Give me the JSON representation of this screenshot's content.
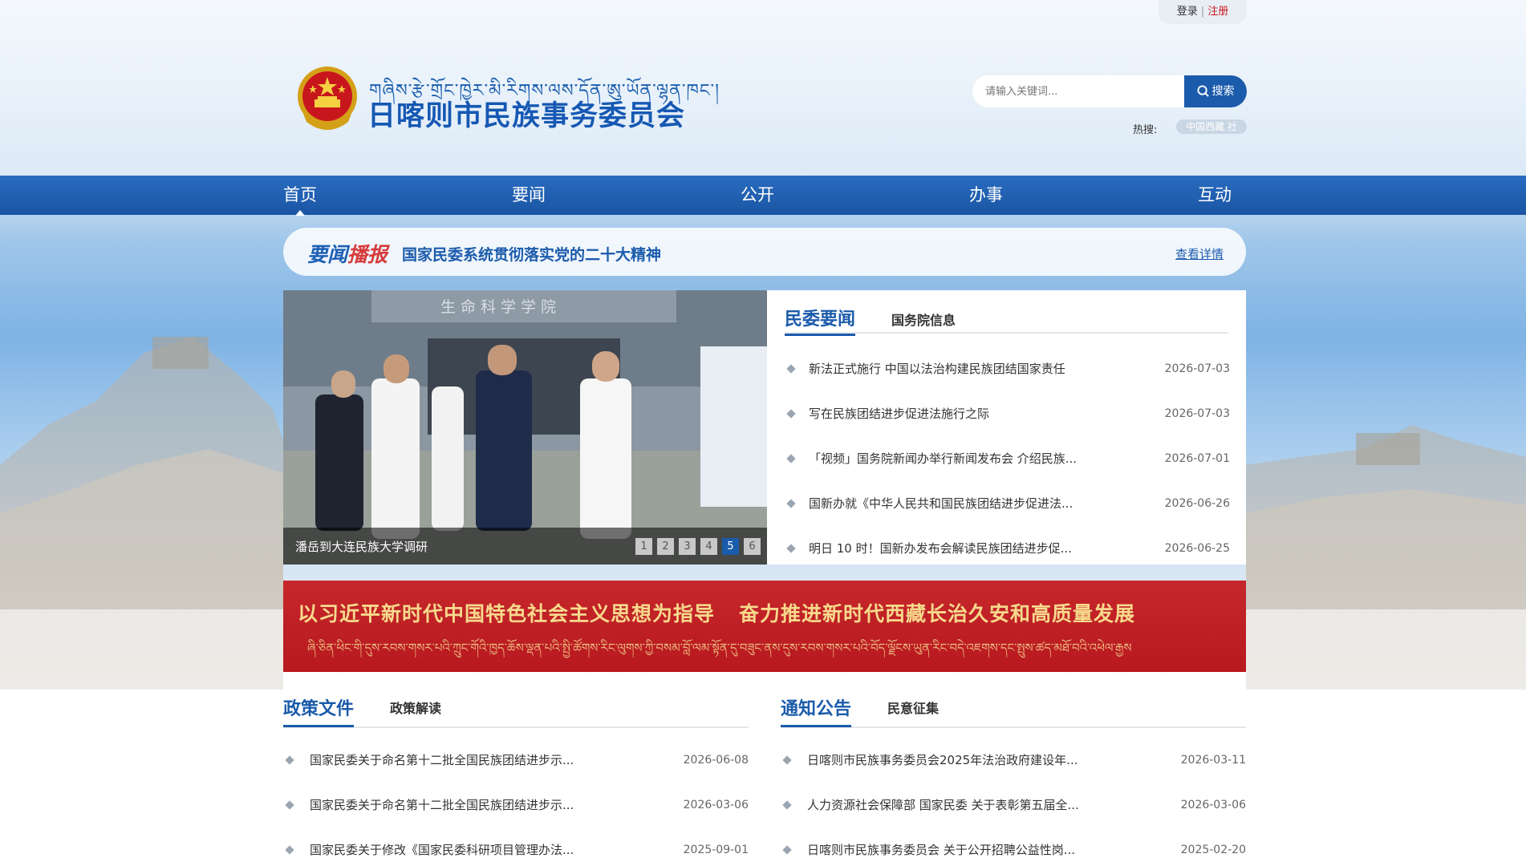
{
  "top_bar": {
    "login": "登录",
    "separator": "|",
    "register": "注册"
  },
  "header": {
    "tibetan_title": "གཞིས་རྩེ་གྲོང་ཁྱེར་མི་རིགས་ལས་དོན་ཨུ་ཡོན་ལྷན་ཁང་།",
    "cn_title": "日喀则市民族事务委员会"
  },
  "search": {
    "placeholder": "请输入关键词...",
    "button_label": "搜索",
    "hot_label": "热搜:",
    "hot_tag": "中国西藏 社"
  },
  "nav": {
    "items": [
      "首页",
      "要闻",
      "公开",
      "办事",
      "互动"
    ]
  },
  "ticker": {
    "logo_main": "要闻",
    "logo_accent": "播报",
    "headline": "国家民委系统贯彻落实党的二十大精神",
    "more": "查看详情"
  },
  "slider": {
    "caption": "潘岳到大连民族大学调研",
    "dots": [
      "1",
      "2",
      "3",
      "4",
      "5",
      "6"
    ],
    "active_dot": 5,
    "photo_sign": "生命科学学院"
  },
  "news_panel": {
    "tab_main": "民委要闻",
    "tab_sub": "国务院信息",
    "items": [
      {
        "title": "新法正式施行 中国以法治构建民族团结国家责任",
        "date": "2026-07-03"
      },
      {
        "title": "写在民族团结进步促进法施行之际",
        "date": "2026-07-03"
      },
      {
        "title": "「视频」国务院新闻办举行新闻发布会 介绍民族...",
        "date": "2026-07-01"
      },
      {
        "title": "国新办就《中华人民共和国民族团结进步促进法...",
        "date": "2026-06-26"
      },
      {
        "title": "明日 10 时！国新办发布会解读民族团结进步促...",
        "date": "2026-06-25"
      }
    ]
  },
  "banner": {
    "line1_a": "以习近平新时代中国特色社会主义思想为指导",
    "line1_b": "奋力推进新时代西藏长治久安和高质量发展",
    "line2": "ཞི་ཅིན་ཕིང་གི་དུས་རབས་གསར་པའི་ཀྲུང་གོའི་ཁྱད་ཆོས་ལྡན་པའི་སྤྱི་ཚོགས་རིང་ལུགས་ཀྱི་བསམ་བློ་ལམ་སྟོན་དུ་བཟུང་ནས་དུས་རབས་གསར་པའི་བོད་ལྗོངས་ཡུན་རིང་བདེ་འཇགས་དང་སྤུས་ཚད་མཐོ་བའི་འཕེལ་རྒྱས"
  },
  "policy": {
    "tab_main": "政策文件",
    "tab_sub": "政策解读",
    "items": [
      {
        "title": "国家民委关于命名第十二批全国民族团结进步示...",
        "date": "2026-06-08"
      },
      {
        "title": "国家民委关于命名第十二批全国民族团结进步示...",
        "date": "2026-03-06"
      },
      {
        "title": "国家民委关于修改《国家民委科研项目管理办法...",
        "date": "2025-09-01"
      }
    ]
  },
  "notice": {
    "tab_main": "通知公告",
    "tab_sub": "民意征集",
    "items": [
      {
        "title": "日喀则市民族事务委员会2025年法治政府建设年...",
        "date": "2026-03-11"
      },
      {
        "title": "人力资源社会保障部 国家民委 关于表彰第五届全...",
        "date": "2026-03-06"
      },
      {
        "title": "日喀则市民族事务委员会 关于公开招聘公益性岗...",
        "date": "2025-02-20"
      }
    ]
  },
  "colors": {
    "primary": "#1b5bab",
    "banner_red": "#c5272b",
    "banner_gold": "#f7d98c"
  }
}
